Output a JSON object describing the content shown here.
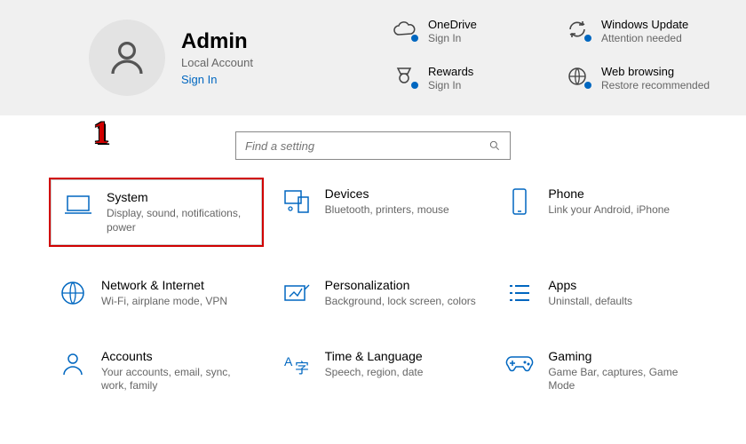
{
  "user": {
    "name": "Admin",
    "type": "Local Account",
    "signin": "Sign In"
  },
  "status": {
    "onedrive": {
      "title": "OneDrive",
      "sub": "Sign In"
    },
    "update": {
      "title": "Windows Update",
      "sub": "Attention needed"
    },
    "rewards": {
      "title": "Rewards",
      "sub": "Sign In"
    },
    "browsing": {
      "title": "Web browsing",
      "sub": "Restore recommended"
    }
  },
  "search": {
    "placeholder": "Find a setting"
  },
  "step_marker": "1",
  "tiles": {
    "system": {
      "title": "System",
      "sub": "Display, sound, notifications, power"
    },
    "devices": {
      "title": "Devices",
      "sub": "Bluetooth, printers, mouse"
    },
    "phone": {
      "title": "Phone",
      "sub": "Link your Android, iPhone"
    },
    "network": {
      "title": "Network & Internet",
      "sub": "Wi-Fi, airplane mode, VPN"
    },
    "personalization": {
      "title": "Personalization",
      "sub": "Background, lock screen, colors"
    },
    "apps": {
      "title": "Apps",
      "sub": "Uninstall, defaults"
    },
    "accounts": {
      "title": "Accounts",
      "sub": "Your accounts, email, sync, work, family"
    },
    "time": {
      "title": "Time & Language",
      "sub": "Speech, region, date"
    },
    "gaming": {
      "title": "Gaming",
      "sub": "Game Bar, captures, Game Mode"
    }
  }
}
